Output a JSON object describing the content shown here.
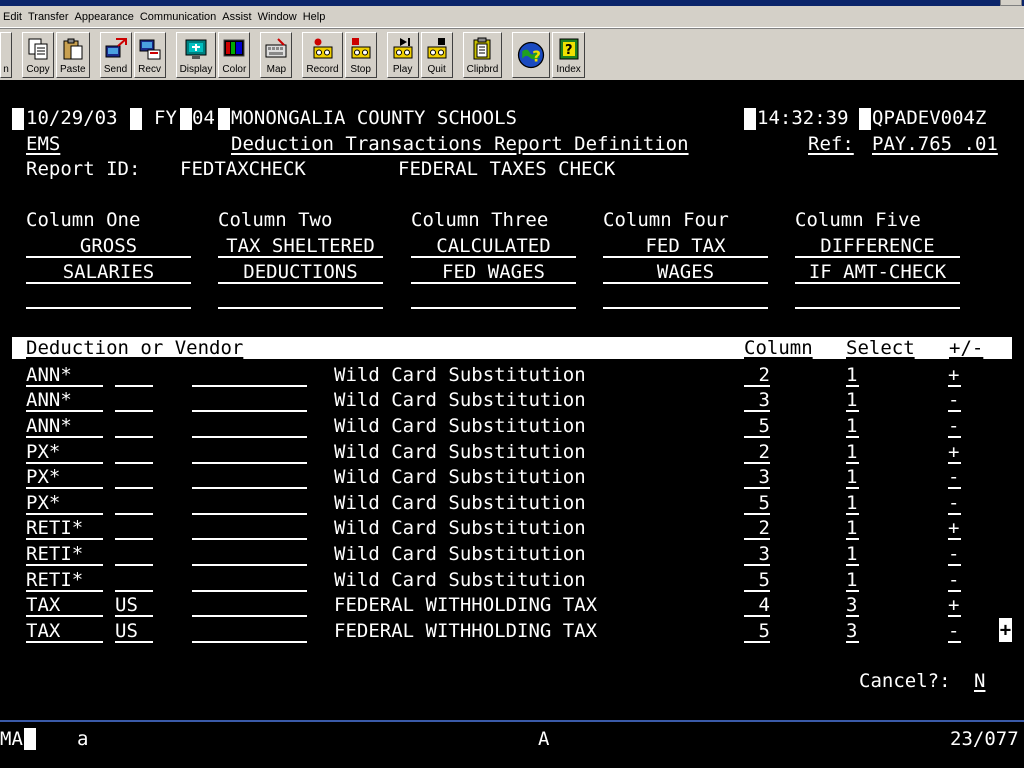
{
  "menu": [
    "Edit",
    "Transfer",
    "Appearance",
    "Communication",
    "Assist",
    "Window",
    "Help"
  ],
  "toolbar": [
    "n",
    "Copy",
    "Paste",
    "Send",
    "Recv",
    "Display",
    "Color",
    "Map",
    "Record",
    "Stop",
    "Play",
    "Quit",
    "Clipbrd",
    "Index"
  ],
  "header": {
    "date": "10/29/03",
    "fy_label": "FY",
    "fy": "04",
    "org": "MONONGALIA COUNTY SCHOOLS",
    "time": "14:32:39",
    "session": "QPADEV004Z",
    "system": "EMS",
    "screen_title": "Deduction Transactions Report Definition",
    "ref_label": "Ref:",
    "ref": "PAY.765 .01"
  },
  "report": {
    "id_label": "Report ID:",
    "id": "FEDTAXCHECK",
    "desc": "FEDERAL TAXES CHECK"
  },
  "columns": [
    {
      "label": "Column One",
      "line1": "GROSS",
      "line2": "SALARIES"
    },
    {
      "label": "Column Two",
      "line1": "TAX SHELTERED",
      "line2": "DEDUCTIONS"
    },
    {
      "label": "Column Three",
      "line1": "CALCULATED",
      "line2": "FED WAGES"
    },
    {
      "label": "Column Four",
      "line1": "FED TAX",
      "line2": "WAGES"
    },
    {
      "label": "Column Five",
      "line1": "DIFFERENCE",
      "line2": "IF AMT-CHECK"
    }
  ],
  "table_header": {
    "deduction": "Deduction or Vendor",
    "column": "Column",
    "select": "Select",
    "sign": "+/-"
  },
  "rows": [
    {
      "code": "ANN*",
      "sub": "",
      "desc": "Wild Card Substitution",
      "column": "2",
      "select": "1",
      "sign": "+"
    },
    {
      "code": "ANN*",
      "sub": "",
      "desc": "Wild Card Substitution",
      "column": "3",
      "select": "1",
      "sign": "-"
    },
    {
      "code": "ANN*",
      "sub": "",
      "desc": "Wild Card Substitution",
      "column": "5",
      "select": "1",
      "sign": "-"
    },
    {
      "code": "PX*",
      "sub": "",
      "desc": "Wild Card Substitution",
      "column": "2",
      "select": "1",
      "sign": "+"
    },
    {
      "code": "PX*",
      "sub": "",
      "desc": "Wild Card Substitution",
      "column": "3",
      "select": "1",
      "sign": "-"
    },
    {
      "code": "PX*",
      "sub": "",
      "desc": "Wild Card Substitution",
      "column": "5",
      "select": "1",
      "sign": "-"
    },
    {
      "code": "RETI*",
      "sub": "",
      "desc": "Wild Card Substitution",
      "column": "2",
      "select": "1",
      "sign": "+"
    },
    {
      "code": "RETI*",
      "sub": "",
      "desc": "Wild Card Substitution",
      "column": "3",
      "select": "1",
      "sign": "-"
    },
    {
      "code": "RETI*",
      "sub": "",
      "desc": "Wild Card Substitution",
      "column": "5",
      "select": "1",
      "sign": "-"
    },
    {
      "code": "TAX",
      "sub": "US",
      "desc": "FEDERAL WITHHOLDING TAX",
      "column": "4",
      "select": "3",
      "sign": "+"
    },
    {
      "code": "TAX",
      "sub": "US",
      "desc": "FEDERAL WITHHOLDING TAX",
      "column": "5",
      "select": "3",
      "sign": "-"
    }
  ],
  "more_indicator": "+",
  "cancel": {
    "label": "Cancel?:",
    "value": "N"
  },
  "status": {
    "mode": "MA",
    "flag": "a",
    "center": "A",
    "position": "23/077"
  }
}
